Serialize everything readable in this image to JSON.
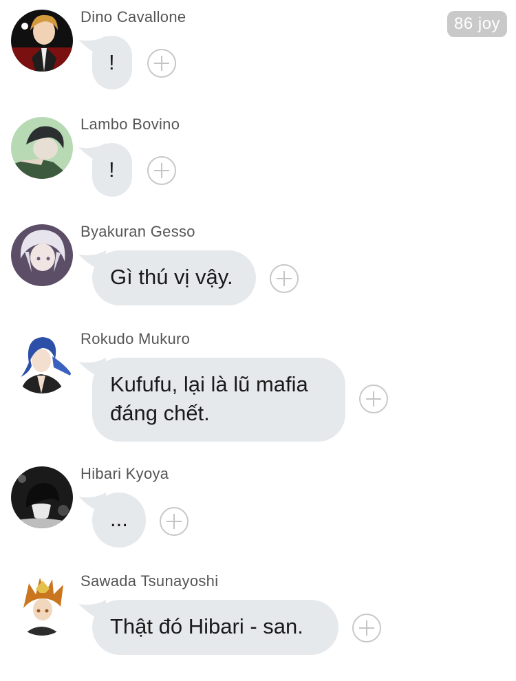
{
  "badge": {
    "text": "86 joy"
  },
  "messages": [
    {
      "name": "Dino Cavallone",
      "text": "!",
      "avatar_icon": "blonde-man-avatar-icon"
    },
    {
      "name": "Lambo Bovino",
      "text": "!",
      "avatar_icon": "dark-hair-man-avatar-icon"
    },
    {
      "name": "Byakuran Gesso",
      "text": "Gì thú vị vậy.",
      "avatar_icon": "white-hair-man-avatar-icon"
    },
    {
      "name": "Rokudo Mukuro",
      "text": "Kufufu, lại là lũ mafia đáng chết.",
      "avatar_icon": "blue-hair-man-avatar-icon"
    },
    {
      "name": "Hibari Kyoya",
      "text": "...",
      "avatar_icon": "black-white-man-avatar-icon"
    },
    {
      "name": "Sawada Tsunayoshi",
      "text": "Thật đó Hibari - san.",
      "avatar_icon": "spiky-hair-boy-avatar-icon"
    }
  ],
  "colors": {
    "bubble": "#e6e9ec",
    "badge": "#c9c9c9",
    "name_text": "#555555"
  }
}
